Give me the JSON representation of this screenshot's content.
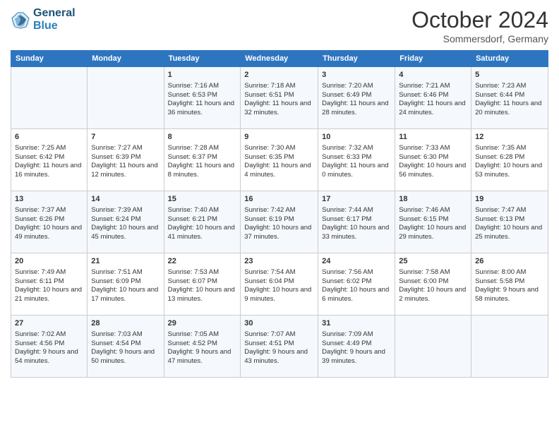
{
  "header": {
    "logo_line1": "General",
    "logo_line2": "Blue",
    "month": "October 2024",
    "location": "Sommersdorf, Germany"
  },
  "weekdays": [
    "Sunday",
    "Monday",
    "Tuesday",
    "Wednesday",
    "Thursday",
    "Friday",
    "Saturday"
  ],
  "rows": [
    [
      {
        "day": "",
        "info": ""
      },
      {
        "day": "",
        "info": ""
      },
      {
        "day": "1",
        "info": "Sunrise: 7:16 AM\nSunset: 6:53 PM\nDaylight: 11 hours and 36 minutes."
      },
      {
        "day": "2",
        "info": "Sunrise: 7:18 AM\nSunset: 6:51 PM\nDaylight: 11 hours and 32 minutes."
      },
      {
        "day": "3",
        "info": "Sunrise: 7:20 AM\nSunset: 6:49 PM\nDaylight: 11 hours and 28 minutes."
      },
      {
        "day": "4",
        "info": "Sunrise: 7:21 AM\nSunset: 6:46 PM\nDaylight: 11 hours and 24 minutes."
      },
      {
        "day": "5",
        "info": "Sunrise: 7:23 AM\nSunset: 6:44 PM\nDaylight: 11 hours and 20 minutes."
      }
    ],
    [
      {
        "day": "6",
        "info": "Sunrise: 7:25 AM\nSunset: 6:42 PM\nDaylight: 11 hours and 16 minutes."
      },
      {
        "day": "7",
        "info": "Sunrise: 7:27 AM\nSunset: 6:39 PM\nDaylight: 11 hours and 12 minutes."
      },
      {
        "day": "8",
        "info": "Sunrise: 7:28 AM\nSunset: 6:37 PM\nDaylight: 11 hours and 8 minutes."
      },
      {
        "day": "9",
        "info": "Sunrise: 7:30 AM\nSunset: 6:35 PM\nDaylight: 11 hours and 4 minutes."
      },
      {
        "day": "10",
        "info": "Sunrise: 7:32 AM\nSunset: 6:33 PM\nDaylight: 11 hours and 0 minutes."
      },
      {
        "day": "11",
        "info": "Sunrise: 7:33 AM\nSunset: 6:30 PM\nDaylight: 10 hours and 56 minutes."
      },
      {
        "day": "12",
        "info": "Sunrise: 7:35 AM\nSunset: 6:28 PM\nDaylight: 10 hours and 53 minutes."
      }
    ],
    [
      {
        "day": "13",
        "info": "Sunrise: 7:37 AM\nSunset: 6:26 PM\nDaylight: 10 hours and 49 minutes."
      },
      {
        "day": "14",
        "info": "Sunrise: 7:39 AM\nSunset: 6:24 PM\nDaylight: 10 hours and 45 minutes."
      },
      {
        "day": "15",
        "info": "Sunrise: 7:40 AM\nSunset: 6:21 PM\nDaylight: 10 hours and 41 minutes."
      },
      {
        "day": "16",
        "info": "Sunrise: 7:42 AM\nSunset: 6:19 PM\nDaylight: 10 hours and 37 minutes."
      },
      {
        "day": "17",
        "info": "Sunrise: 7:44 AM\nSunset: 6:17 PM\nDaylight: 10 hours and 33 minutes."
      },
      {
        "day": "18",
        "info": "Sunrise: 7:46 AM\nSunset: 6:15 PM\nDaylight: 10 hours and 29 minutes."
      },
      {
        "day": "19",
        "info": "Sunrise: 7:47 AM\nSunset: 6:13 PM\nDaylight: 10 hours and 25 minutes."
      }
    ],
    [
      {
        "day": "20",
        "info": "Sunrise: 7:49 AM\nSunset: 6:11 PM\nDaylight: 10 hours and 21 minutes."
      },
      {
        "day": "21",
        "info": "Sunrise: 7:51 AM\nSunset: 6:09 PM\nDaylight: 10 hours and 17 minutes."
      },
      {
        "day": "22",
        "info": "Sunrise: 7:53 AM\nSunset: 6:07 PM\nDaylight: 10 hours and 13 minutes."
      },
      {
        "day": "23",
        "info": "Sunrise: 7:54 AM\nSunset: 6:04 PM\nDaylight: 10 hours and 9 minutes."
      },
      {
        "day": "24",
        "info": "Sunrise: 7:56 AM\nSunset: 6:02 PM\nDaylight: 10 hours and 6 minutes."
      },
      {
        "day": "25",
        "info": "Sunrise: 7:58 AM\nSunset: 6:00 PM\nDaylight: 10 hours and 2 minutes."
      },
      {
        "day": "26",
        "info": "Sunrise: 8:00 AM\nSunset: 5:58 PM\nDaylight: 9 hours and 58 minutes."
      }
    ],
    [
      {
        "day": "27",
        "info": "Sunrise: 7:02 AM\nSunset: 4:56 PM\nDaylight: 9 hours and 54 minutes."
      },
      {
        "day": "28",
        "info": "Sunrise: 7:03 AM\nSunset: 4:54 PM\nDaylight: 9 hours and 50 minutes."
      },
      {
        "day": "29",
        "info": "Sunrise: 7:05 AM\nSunset: 4:52 PM\nDaylight: 9 hours and 47 minutes."
      },
      {
        "day": "30",
        "info": "Sunrise: 7:07 AM\nSunset: 4:51 PM\nDaylight: 9 hours and 43 minutes."
      },
      {
        "day": "31",
        "info": "Sunrise: 7:09 AM\nSunset: 4:49 PM\nDaylight: 9 hours and 39 minutes."
      },
      {
        "day": "",
        "info": ""
      },
      {
        "day": "",
        "info": ""
      }
    ]
  ]
}
